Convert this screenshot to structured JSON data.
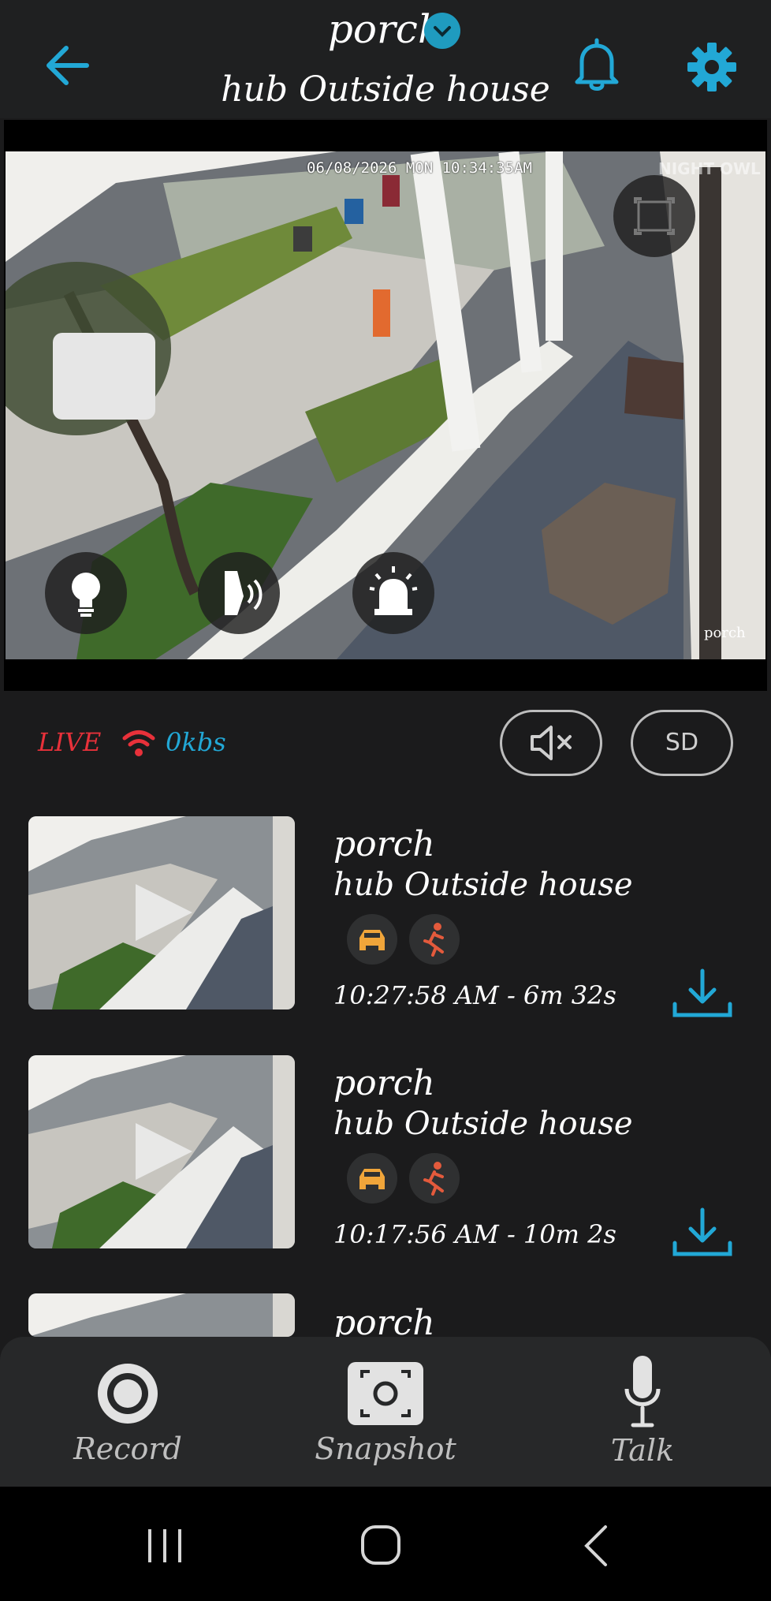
{
  "header": {
    "title": "porch",
    "subtitle": "hub Outside house",
    "icons": [
      "back-arrow-icon",
      "chevron-down-icon",
      "bell-icon",
      "gear-icon"
    ]
  },
  "video": {
    "overlay_timestamp": "06/08/2026 MON 10:34:35AM",
    "brand_watermark": "NIGHT OWL",
    "camera_label": "porch",
    "buttons": [
      "light-bulb-icon",
      "speaker-siren-icon",
      "siren-alarm-icon",
      "fullscreen-icon"
    ]
  },
  "status": {
    "live": "LIVE",
    "bitrate": "0kbs",
    "sd_label": "SD"
  },
  "clips": [
    {
      "title": "porch",
      "subtitle": "hub Outside house",
      "time": "10:27:58 AM - 6m 32s",
      "tags": [
        "car-icon",
        "running-person-icon"
      ]
    },
    {
      "title": "porch",
      "subtitle": "hub Outside house",
      "time": "10:17:56 AM - 10m 2s",
      "tags": [
        "car-icon",
        "running-person-icon"
      ]
    },
    {
      "title": "porch"
    }
  ],
  "bottom_bar": {
    "record": "Record",
    "snapshot": "Snapshot",
    "talk": "Talk"
  },
  "colors": {
    "accent": "#22a8d6",
    "live_red": "#e8313a",
    "tag_orange": "#f0a53a",
    "tag_red": "#e35a3c"
  }
}
